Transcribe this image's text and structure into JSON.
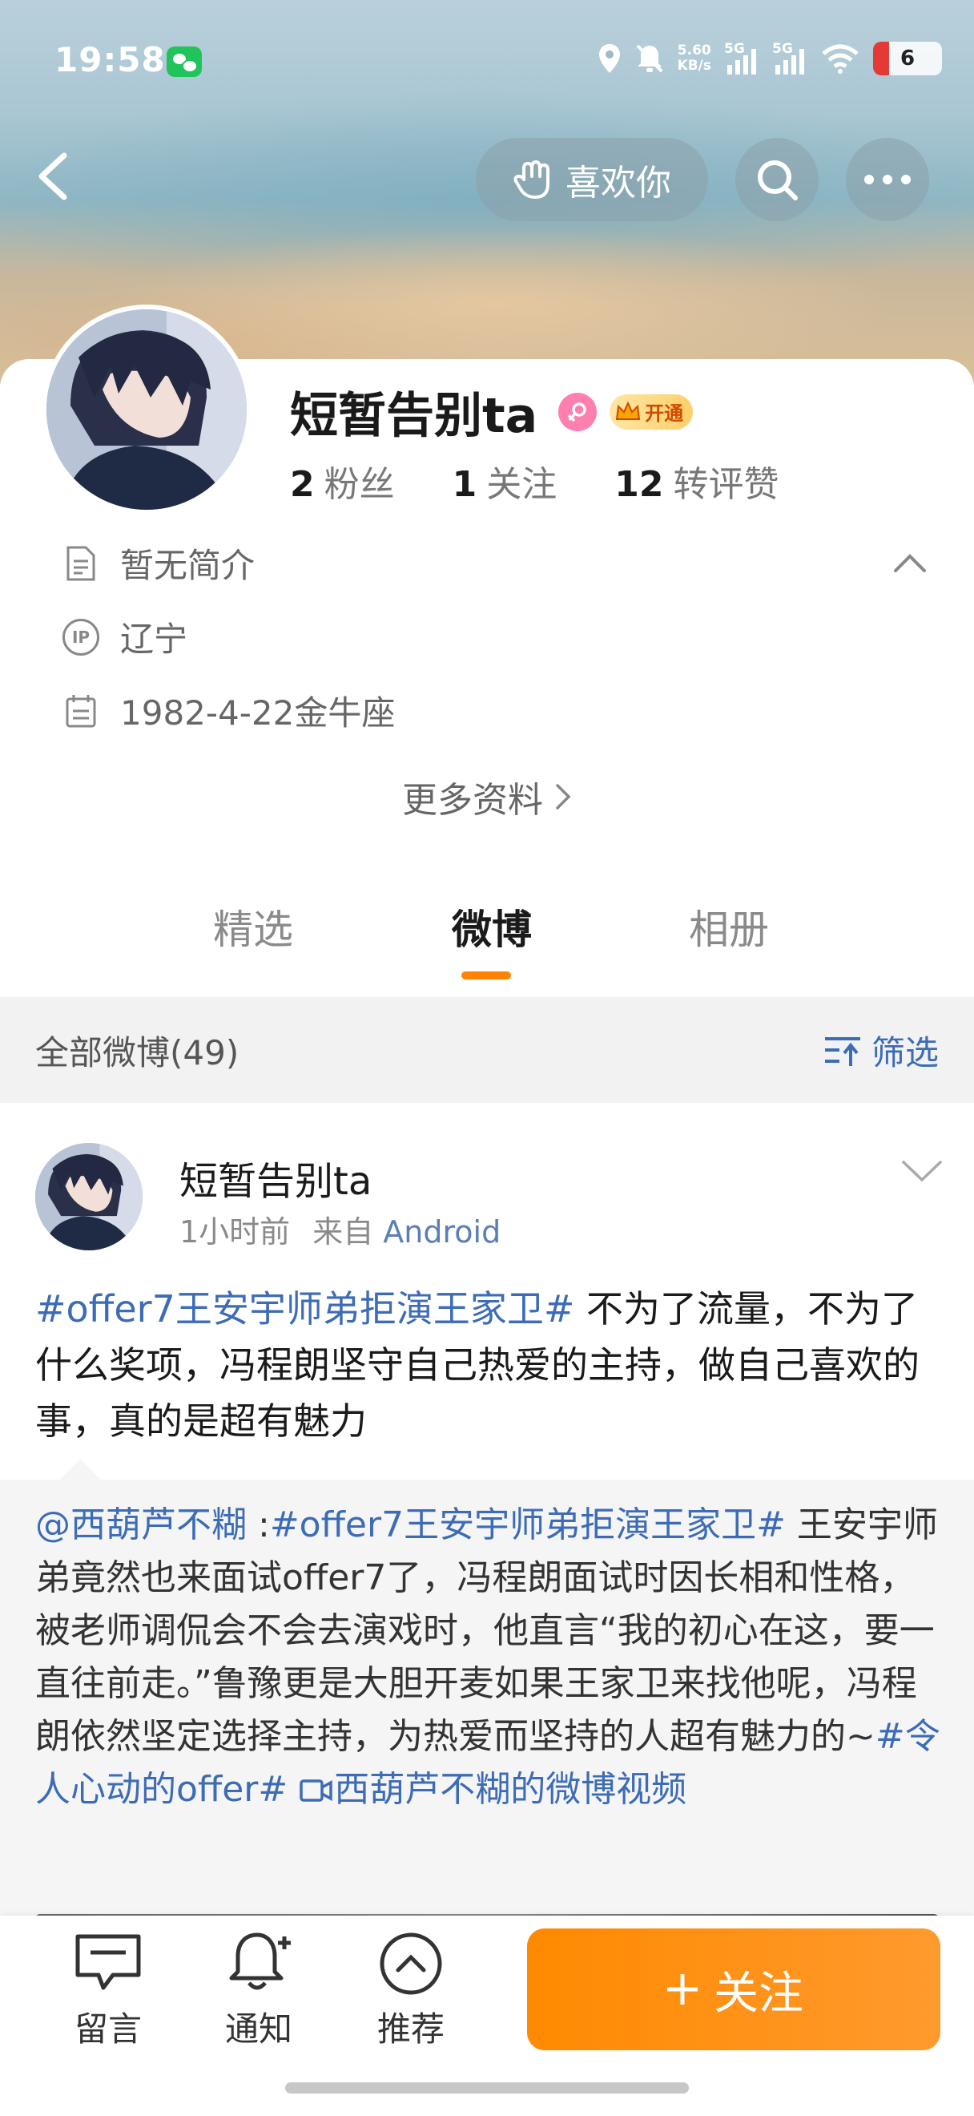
{
  "status_bar": {
    "time": "19:58",
    "net_speed_value": "5.60",
    "net_speed_unit": "KB/s",
    "signal_1": "5G",
    "signal_2": "5G",
    "battery": "6"
  },
  "nav": {
    "like_label": "喜欢你"
  },
  "profile": {
    "name": "短暂告别ta",
    "vip_label": "开通",
    "stats": [
      {
        "num": "2",
        "label": "粉丝"
      },
      {
        "num": "1",
        "label": "关注"
      },
      {
        "num": "12",
        "label": "转评赞"
      }
    ],
    "bio": "暂无简介",
    "ip_icon_text": "IP",
    "ip": "辽宁",
    "birthday": "1982-4-22金牛座",
    "more_info": "更多资料"
  },
  "tabs": [
    {
      "label": "精选",
      "active": false
    },
    {
      "label": "微博",
      "active": true
    },
    {
      "label": "相册",
      "active": false
    }
  ],
  "filter": {
    "count_label": "全部微博(49)",
    "filter_label": "筛选"
  },
  "post": {
    "author": "短暂告别ta",
    "time": "1小时前",
    "source_prefix": "来自",
    "source": "Android",
    "topic": "#offer7王安宇师弟拒演王家卫#",
    "text": " 不为了流量，不为了什么奖项，冯程朗坚守自己热爱的主持，做自己喜欢的事，真的是超有魅力",
    "repost": {
      "user": "@西葫芦不糊",
      "colon": " :",
      "topic": "#offer7王安宇师弟拒演王家卫#",
      "text": " 王安宇师弟竟然也来面试offer7了，冯程朗面试时因长相和性格，被老师调侃会不会去演戏时，他直言“我的初心在这，要一直往前走。”鲁豫更是大胆开麦如果王家卫来找他呢，冯程朗依然坚定选择主持，为热爱而坚持的人超有魅力的~",
      "topic2": "#令人心动的offer#",
      "video_link": "西葫芦不糊的微博视频"
    }
  },
  "bottom_bar": {
    "message": "留言",
    "notify": "通知",
    "recommend": "推荐",
    "follow": "关注"
  },
  "colors": {
    "accent": "#ff8200",
    "link": "#3d6cb7",
    "follow_button": "#ff9a2e"
  }
}
